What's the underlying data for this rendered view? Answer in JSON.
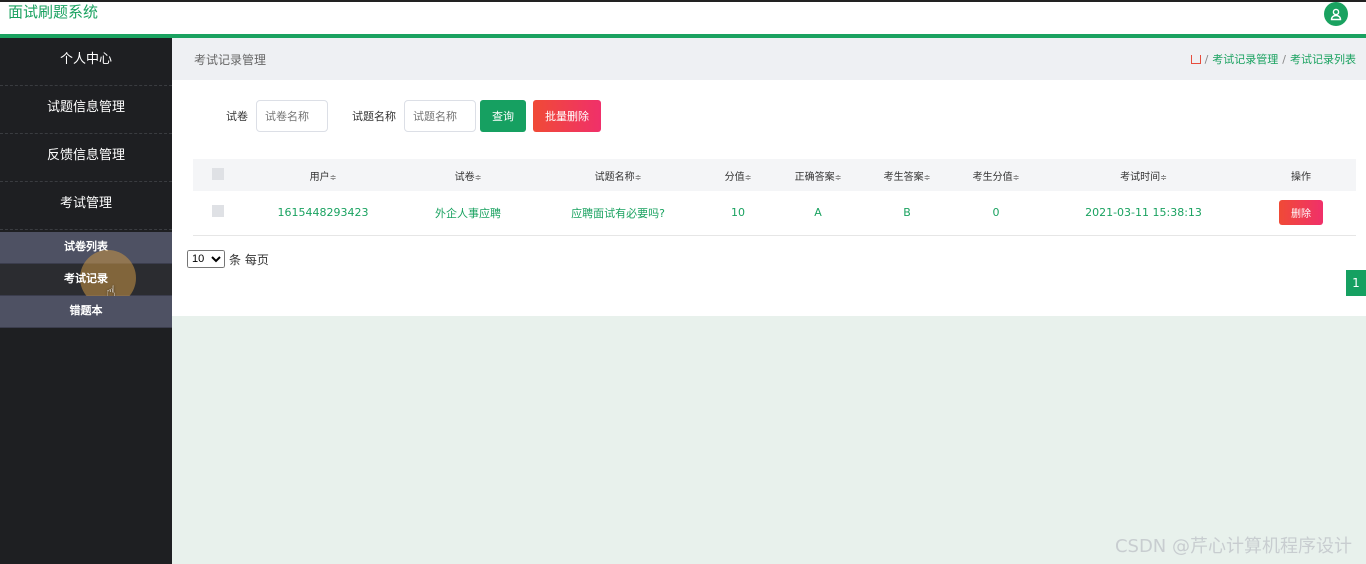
{
  "app": {
    "title": "面试刷题系统"
  },
  "sidebar": {
    "items": [
      {
        "label": "个人中心"
      },
      {
        "label": "试题信息管理"
      },
      {
        "label": "反馈信息管理"
      },
      {
        "label": "考试管理"
      }
    ],
    "submenu": [
      {
        "label": "试卷列表"
      },
      {
        "label": "考试记录"
      },
      {
        "label": "错题本"
      }
    ]
  },
  "page": {
    "title": "考试记录管理",
    "breadcrumb": {
      "level1": "考试记录管理",
      "level2": "考试记录列表"
    }
  },
  "search": {
    "paper_label": "试卷",
    "paper_placeholder": "试卷名称",
    "question_label": "试题名称",
    "question_placeholder": "试题名称",
    "query_label": "查询",
    "batch_delete_label": "批量删除"
  },
  "table": {
    "headers": [
      "用户",
      "试卷",
      "试题名称",
      "分值",
      "正确答案",
      "考生答案",
      "考生分值",
      "考试时间",
      "操作"
    ],
    "sort_glyph": "≑",
    "rows": [
      {
        "user": "1615448293423",
        "paper": "外企人事应聘",
        "question": "应聘面试有必要吗?",
        "score": "10",
        "correct": "A",
        "answer": "B",
        "got": "0",
        "time": "2021-03-11 15:38:13",
        "action": "删除"
      }
    ]
  },
  "pager": {
    "page_size": "10",
    "suffix": "条 每页",
    "current_page": "1"
  },
  "watermark": "CSDN @芹心计算机程序设计",
  "colors": {
    "accent": "#1aa260",
    "danger": "#f04a36",
    "sidebar": "#1e1f22"
  }
}
